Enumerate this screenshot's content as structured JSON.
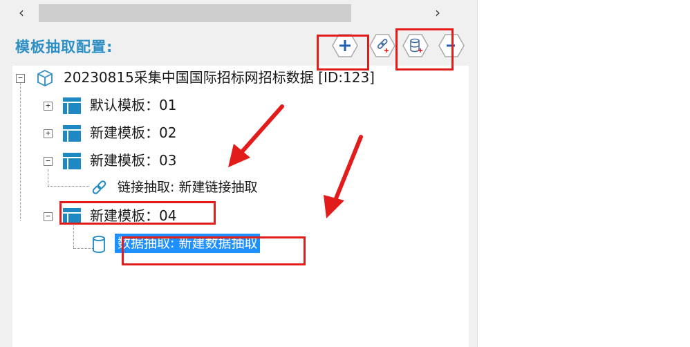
{
  "scrollbar": {
    "left_arrow": "‹",
    "right_arrow": "›"
  },
  "section": {
    "title": "模板抽取配置:"
  },
  "toolbar": {
    "add_label": "+",
    "remove_label": "-"
  },
  "tree": {
    "root": {
      "label": "20230815采集中国国际招标网招标数据 [ID:123]"
    },
    "items": [
      {
        "label": "默认模板：01",
        "expanded": false
      },
      {
        "label": "新建模板：02",
        "expanded": false
      },
      {
        "label": "新建模板：03",
        "expanded": true,
        "child": {
          "label": "链接抽取: 新建链接抽取"
        }
      },
      {
        "label": "新建模板：04",
        "expanded": true,
        "child": {
          "label": "数据抽取: 新建数据抽取",
          "selected": true
        }
      }
    ]
  },
  "colors": {
    "accent": "#2d8fc4",
    "selection": "#1e90ff",
    "highlight": "#e21b1b"
  }
}
